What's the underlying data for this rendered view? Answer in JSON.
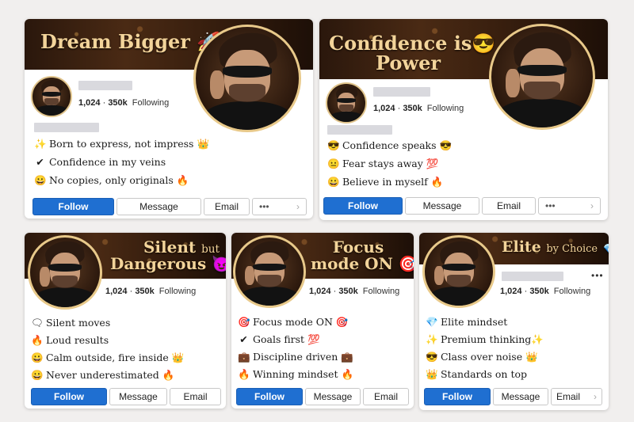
{
  "colors": {
    "follow": "#1f6fd1",
    "banner_title": "#f3d49a",
    "avatar_border": "#e8c98a"
  },
  "cards": [
    {
      "title_line1": "Dream Bigger",
      "title_emoji": "🚀",
      "stats": {
        "posts": "1,024",
        "followers": "350k",
        "following": "Following"
      },
      "bio": [
        {
          "icon": "✨",
          "text": "Born to express, not impress",
          "end": "👑"
        },
        {
          "icon": "✔",
          "text": "Confidence in my veins",
          "end": ""
        },
        {
          "icon": "😀",
          "text": "No copies, only originals",
          "end": "🔥"
        }
      ],
      "buttons": {
        "follow": "Follow",
        "message": "Message",
        "email": "Email",
        "more": "•••",
        "chevron": "›"
      }
    },
    {
      "title_line1": "Confidence is",
      "title_emoji": "😎",
      "title_line2": "Power",
      "stats": {
        "posts": "1,024",
        "followers": "350k",
        "following": "Following"
      },
      "bio": [
        {
          "icon": "😎",
          "text": "Confidence speaks",
          "end": "😎"
        },
        {
          "icon": "😐",
          "text": "Fear stays away",
          "end": "💯"
        },
        {
          "icon": "😀",
          "text": "Believe in myself",
          "end": "🔥"
        }
      ],
      "buttons": {
        "follow": "Follow",
        "message": "Message",
        "email": "Email",
        "more": "•••",
        "chevron": "›"
      }
    },
    {
      "title_line1": "Silent",
      "title_small": "but",
      "title_line2": "Dangerous",
      "title_emoji": "😈",
      "stats": {
        "posts": "1,024",
        "followers": "350k",
        "following": "Following"
      },
      "bio": [
        {
          "icon": "🗨",
          "text": "Silent moves",
          "end": ""
        },
        {
          "icon": "🔥",
          "text": "Loud results",
          "end": ""
        },
        {
          "icon": "😀",
          "text": "Calm outside, fire inside",
          "end": "👑"
        },
        {
          "icon": "😀",
          "text": "Never underestimated",
          "end": "🔥"
        }
      ],
      "buttons": {
        "follow": "Follow",
        "message": "Message",
        "email": "Email"
      }
    },
    {
      "title_line1": "Focus",
      "title_line2": "mode ON",
      "title_emoji": "🎯",
      "stats": {
        "posts": "1,024",
        "followers": "350k",
        "following": "Following"
      },
      "bio": [
        {
          "icon": "🎯",
          "text": "Focus mode ON",
          "end": "🎯"
        },
        {
          "icon": "✔",
          "text": "Goals first",
          "end": "💯"
        },
        {
          "icon": "💼",
          "text": "Discipline driven",
          "end": "💼"
        },
        {
          "icon": "🔥",
          "text": "Winning mindset",
          "end": "🔥"
        }
      ],
      "buttons": {
        "follow": "Follow",
        "message": "Message",
        "email": "Email"
      }
    },
    {
      "title_line1": "Elite",
      "title_small": "by Choice",
      "title_emoji": "💎",
      "stats": {
        "posts": "1,024",
        "followers": "350k",
        "following": "Following"
      },
      "bio": [
        {
          "icon": "💎",
          "text": "Elite mindset",
          "end": ""
        },
        {
          "icon": "✨",
          "text": "Premium thinking",
          "end": "✨"
        },
        {
          "icon": "😎",
          "text": "Class over noise",
          "end": "👑"
        },
        {
          "icon": "👑",
          "text": "Standards on top",
          "end": ""
        }
      ],
      "buttons": {
        "follow": "Follow",
        "message": "Message",
        "email": "Email",
        "chevron": "›",
        "menu": "•••"
      }
    }
  ]
}
